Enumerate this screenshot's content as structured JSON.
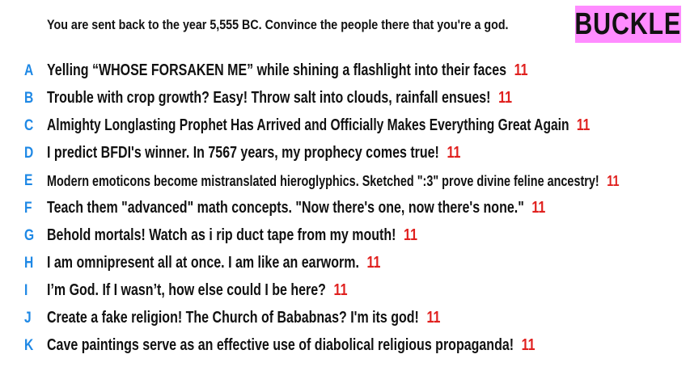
{
  "prompt": "You are sent back to the year 5,555 BC. Convince the people there that you're a god.",
  "badge": {
    "label": "BUCKLE",
    "color": "#ff8cff"
  },
  "colors": {
    "letter": "#1e88e5",
    "score": "#e0201e",
    "text": "#111111"
  },
  "entries": [
    {
      "letter": "A",
      "text": "Yelling “WHOSE FORSAKEN ME” while shining a flashlight into their faces",
      "score": "11"
    },
    {
      "letter": "B",
      "text": "Trouble with crop growth? Easy! Throw salt into clouds, rainfall ensues!",
      "score": "11"
    },
    {
      "letter": "C",
      "text": "Almighty Longlasting Prophet Has Arrived and Officially Makes Everything Great Again",
      "score": "11"
    },
    {
      "letter": "D",
      "text": "I predict BFDI's winner. In 7567 years, my prophecy comes true!",
      "score": "11"
    },
    {
      "letter": "E",
      "text": "Modern emoticons become mistranslated hieroglyphics. Sketched \":3\" prove divine feline ancestry!",
      "score": "11"
    },
    {
      "letter": "F",
      "text": "Teach them \"advanced\" math concepts. \"Now there's one, now there's none.\"",
      "score": "11"
    },
    {
      "letter": "G",
      "text": "Behold mortals! Watch as i rip duct tape from my mouth!",
      "score": "11"
    },
    {
      "letter": "H",
      "text": "I am omnipresent all at once. I am like an earworm.",
      "score": "11"
    },
    {
      "letter": "I",
      "text": "I’m God. If I wasn’t, how else could I be here?",
      "score": "11"
    },
    {
      "letter": "J",
      "text": "Create a fake religion! The Church of Bababnas? I'm its god!",
      "score": "11"
    },
    {
      "letter": "K",
      "text": "Cave paintings serve as an effective use of diabolical religious propaganda!",
      "score": "11"
    }
  ]
}
